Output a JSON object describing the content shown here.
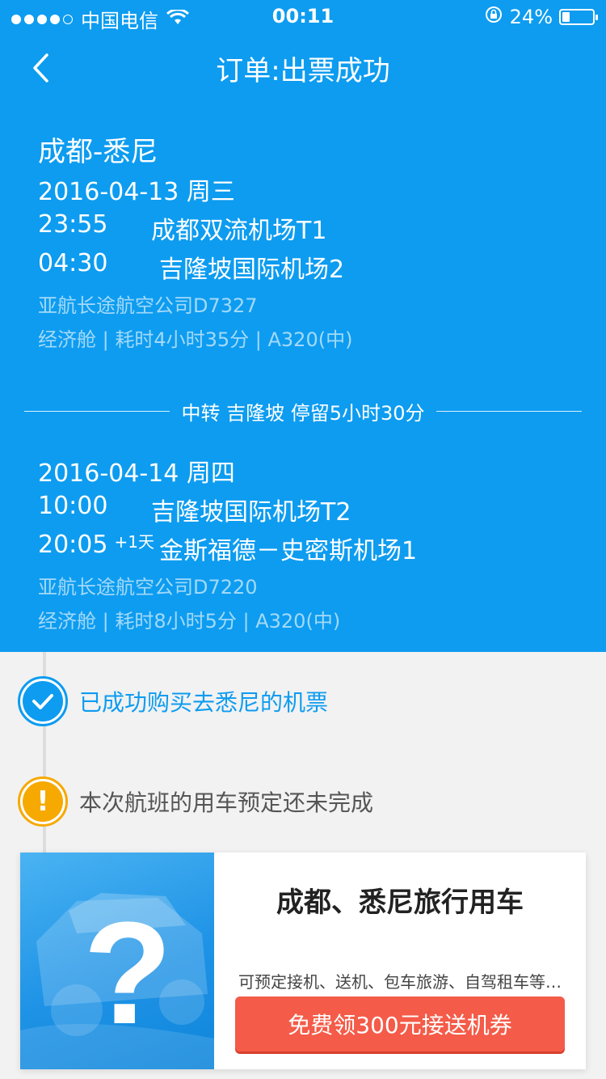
{
  "status_bar": {
    "carrier": "中国电信",
    "time": "00:11",
    "battery": "24%",
    "battery_level": 0.24
  },
  "nav": {
    "title": "订单:出票成功"
  },
  "segment1": {
    "route": "成都-悉尼",
    "date": "2016-04-13 周三",
    "dep_time": "23:55",
    "dep_airport": "成都双流机场T1",
    "arr_time": "04:30",
    "arr_airport": "吉隆坡国际机场2",
    "airline": "亚航长途航空公司D7327",
    "details": "经济舱 | 耗时4小时35分 | A320(中)"
  },
  "transfer": {
    "text": "中转 吉隆坡 停留5小时30分"
  },
  "segment2": {
    "date": "2016-04-14 周四",
    "dep_time": "10:00",
    "dep_airport": "吉隆坡国际机场T2",
    "arr_time": "20:05",
    "arr_plus": "+1天",
    "arr_airport": "金斯福德－史密斯机场1",
    "airline": "亚航长途航空公司D7220",
    "details": "经济舱 | 耗时8小时5分 | A320(中)"
  },
  "statuses": [
    {
      "label": "已成功购买去悉尼的机票"
    },
    {
      "label": "本次航班的用车预定还未完成",
      "icon_text": "!"
    }
  ],
  "card": {
    "placeholder_symbol": "?",
    "title": "成都、悉尼旅行用车",
    "desc": "可预定接机、送机、包车旅游、自驾租车等…",
    "button": "免费领300元接送机券"
  },
  "colors": {
    "primary": "#0d9cf0",
    "warning": "#f6a900",
    "cta": "#f45b48"
  }
}
